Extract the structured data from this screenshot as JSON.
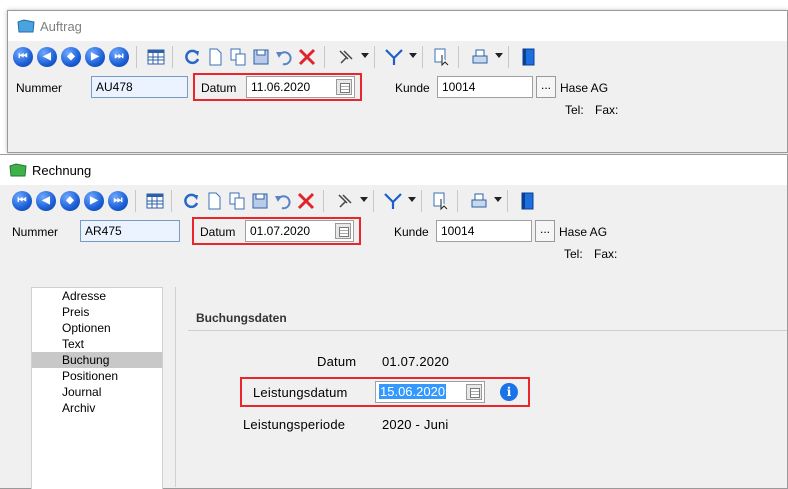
{
  "auftrag": {
    "title": "Auftrag",
    "nummer_label": "Nummer",
    "nummer_value": "AU478",
    "datum_label": "Datum",
    "datum_value": "11.06.2020",
    "kunde_label": "Kunde",
    "kunde_value": "10014",
    "lookup_label": "...",
    "kunde_name": "Hase AG",
    "tel_label": "Tel:",
    "fax_label": "Fax:"
  },
  "rechnung": {
    "title": "Rechnung",
    "nummer_label": "Nummer",
    "nummer_value": "AR475",
    "datum_label": "Datum",
    "datum_value": "01.07.2020",
    "kunde_label": "Kunde",
    "kunde_value": "10014",
    "lookup_label": "...",
    "kunde_name": "Hase AG",
    "tel_label": "Tel:",
    "fax_label": "Fax:"
  },
  "toolbar": {
    "icons": [
      "first-record-icon",
      "previous-record-icon",
      "next-alt-icon",
      "next-record-icon",
      "last-record-icon",
      "table-view-icon",
      "refresh-icon",
      "new-document-icon",
      "copy-icon",
      "save-icon",
      "undo-icon",
      "delete-icon",
      "pin-icon",
      "filter-icon",
      "cursor-select-icon",
      "print-icon",
      "book-icon"
    ],
    "nav_glyphs": [
      "⏮",
      "◀",
      "◆",
      "▶",
      "⏭"
    ]
  },
  "sidebar": {
    "items": [
      {
        "label": "Adresse"
      },
      {
        "label": "Preis"
      },
      {
        "label": "Optionen"
      },
      {
        "label": "Text"
      },
      {
        "label": "Buchung",
        "selected": true
      },
      {
        "label": "Positionen"
      },
      {
        "label": "Journal"
      },
      {
        "label": "Archiv"
      }
    ]
  },
  "buchung": {
    "heading": "Buchungsdaten",
    "datum_label": "Datum",
    "datum_value": "01.07.2020",
    "leistungsdatum_label": "Leistungsdatum",
    "leistungsdatum_value": "15.06.2020",
    "info_glyph": "i",
    "leistungsperiode_label": "Leistungsperiode",
    "leistungsperiode_value": "2020 - Juni"
  },
  "colors": {
    "highlight": "#e8262b",
    "selection": "#3399ff",
    "info": "#1a73e8"
  }
}
